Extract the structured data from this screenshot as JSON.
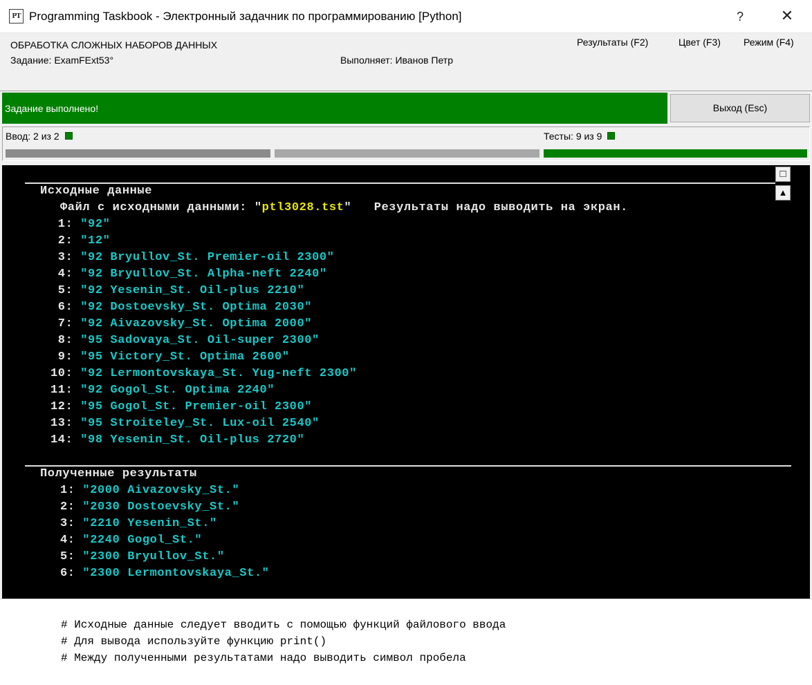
{
  "window": {
    "title": "Programming Taskbook - Электронный задачник по программированию [Python]",
    "icon_text": "PT",
    "help_label": "?",
    "close_label": "✕"
  },
  "header": {
    "task_group": "ОБРАБОТКА СЛОЖНЫХ НАБОРОВ ДАННЫХ",
    "task_name": "Задание: ExamFExt53°",
    "performer": "Выполняет: Иванов Петр",
    "menu": [
      "Результаты (F2)",
      "Цвет (F3)",
      "Режим (F4)"
    ]
  },
  "status": {
    "message": "Задание выполнено!",
    "exit_label": "Выход (Esc)",
    "color": "#008000"
  },
  "progress": {
    "input_label": "Ввод:",
    "input_value": "2 из 2",
    "tests_label": "Тесты:",
    "tests_value": "9 из 9",
    "tests_fraction": 1.0
  },
  "console": {
    "input_header": "Исходные данные",
    "file_label": "Файл с исходными данными: \"",
    "file_name": "ptl3028.tst",
    "file_suffix": "\"   Результаты надо выводить на экран.",
    "input_lines": [
      {
        "num": " 1: ",
        "text": "\"92\""
      },
      {
        "num": " 2: ",
        "text": "\"12\""
      },
      {
        "num": " 3: ",
        "text": "\"92 Bryullov_St. Premier-oil 2300\""
      },
      {
        "num": " 4: ",
        "text": "\"92 Bryullov_St. Alpha-neft 2240\""
      },
      {
        "num": " 5: ",
        "text": "\"92 Yesenin_St. Oil-plus 2210\""
      },
      {
        "num": " 6: ",
        "text": "\"92 Dostoevsky_St. Optima 2030\""
      },
      {
        "num": " 7: ",
        "text": "\"92 Aivazovsky_St. Optima 2000\""
      },
      {
        "num": " 8: ",
        "text": "\"95 Sadovaya_St. Oil-super 2300\""
      },
      {
        "num": " 9: ",
        "text": "\"95 Victory_St. Optima 2600\""
      },
      {
        "num": "10: ",
        "text": "\"92 Lermontovskaya_St. Yug-neft 2300\""
      },
      {
        "num": "11: ",
        "text": "\"92 Gogol_St. Optima 2240\""
      },
      {
        "num": "12: ",
        "text": "\"95 Gogol_St. Premier-oil 2300\""
      },
      {
        "num": "13: ",
        "text": "\"95 Stroiteley_St. Lux-oil 2540\""
      },
      {
        "num": "14: ",
        "text": "\"98 Yesenin_St. Oil-plus 2720\""
      }
    ],
    "output_header": "Полученные результаты",
    "output_lines": [
      {
        "num": "1: ",
        "text": "\"2000 Aivazovsky_St.\""
      },
      {
        "num": "2: ",
        "text": "\"2030 Dostoevsky_St.\""
      },
      {
        "num": "3: ",
        "text": "\"2210 Yesenin_St.\""
      },
      {
        "num": "4: ",
        "text": "\"2240 Gogol_St.\""
      },
      {
        "num": "5: ",
        "text": "\"2300 Bryullov_St.\""
      },
      {
        "num": "6: ",
        "text": "\"2300 Lermontovskaya_St.\""
      }
    ],
    "maximize_icon": "□",
    "scroll_up_icon": "▲"
  },
  "notes": [
    "# Исходные данные следует вводить с помощью функций файлового ввода",
    "# Для вывода используйте функцию print()",
    "# Между полученными результатами надо выводить символ пробела"
  ]
}
